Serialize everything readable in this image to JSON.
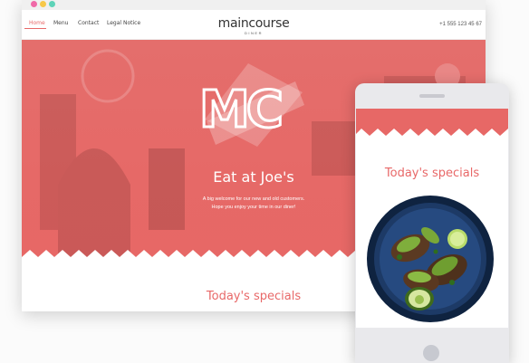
{
  "desktop": {
    "nav": {
      "links": [
        "Home",
        "Menu",
        "Contact",
        "Legal Notice"
      ],
      "active": "Home"
    },
    "brand": {
      "name": "maincourse",
      "subtitle": "DINER"
    },
    "phone": "+1 555 123 45 67",
    "hero": {
      "logo_text": "MC",
      "title": "Eat at Joe's",
      "subtitle_line1": "A big welcome for our new and old customers.",
      "subtitle_line2": "Hope you enjoy your time in our diner!"
    },
    "section_title": "Today's specials"
  },
  "mobile": {
    "section_title": "Today's specials"
  },
  "colors": {
    "accent": "#e86868",
    "hero": "#e66967",
    "dot_red": "#f06aa8",
    "dot_yellow": "#f7c84a",
    "dot_green": "#5ed3b8"
  }
}
